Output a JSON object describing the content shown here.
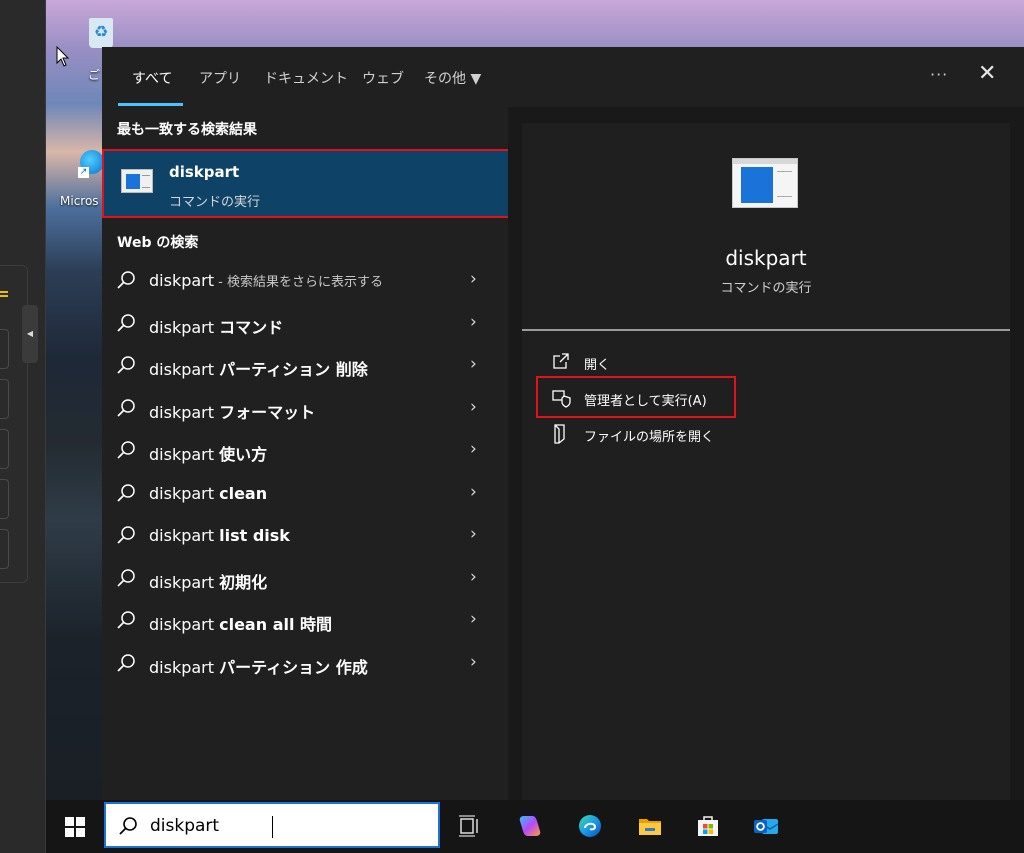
{
  "desktop": {
    "recycle_label": "ご",
    "edge_label": "Micros"
  },
  "tabs": [
    {
      "label": "すべて"
    },
    {
      "label": "アプリ"
    },
    {
      "label": "ドキュメント"
    },
    {
      "label": "ウェブ"
    },
    {
      "label": "その他 ▼"
    }
  ],
  "header": {
    "more": "···",
    "close": "✕"
  },
  "best_match": {
    "section_title": "最も一致する検索結果",
    "name": "diskpart",
    "subtitle": "コマンドの実行"
  },
  "web": {
    "section_title": "Web の検索",
    "items": [
      {
        "query": "diskpart",
        "strong": "",
        "hint": " - 検索結果をさらに表示する"
      },
      {
        "query": "diskpart ",
        "strong": "コマンド",
        "hint": ""
      },
      {
        "query": "diskpart ",
        "strong": "パーティション 削除",
        "hint": ""
      },
      {
        "query": "diskpart ",
        "strong": "フォーマット",
        "hint": ""
      },
      {
        "query": "diskpart ",
        "strong": "使い方",
        "hint": ""
      },
      {
        "query": "diskpart ",
        "strong": "clean",
        "hint": ""
      },
      {
        "query": "diskpart ",
        "strong": "list disk",
        "hint": ""
      },
      {
        "query": "diskpart ",
        "strong": "初期化",
        "hint": ""
      },
      {
        "query": "diskpart ",
        "strong": "clean all 時間",
        "hint": ""
      },
      {
        "query": "diskpart ",
        "strong": "パーティション 作成",
        "hint": ""
      }
    ],
    "chevron": "›"
  },
  "preview": {
    "name": "diskpart",
    "subtitle": "コマンドの実行",
    "actions": [
      {
        "label": "開く"
      },
      {
        "label": "管理者として実行(A)"
      },
      {
        "label": "ファイルの場所を開く"
      }
    ]
  },
  "taskbar": {
    "search_value": "diskpart",
    "icons": [
      "task-view-icon",
      "copilot-icon",
      "edge-icon",
      "file-explorer-icon",
      "microsoft-store-icon",
      "outlook-icon"
    ]
  },
  "colors": {
    "accent": "#4cc2ff",
    "selection": "#0e4267",
    "annotation_red": "#e1121b"
  }
}
